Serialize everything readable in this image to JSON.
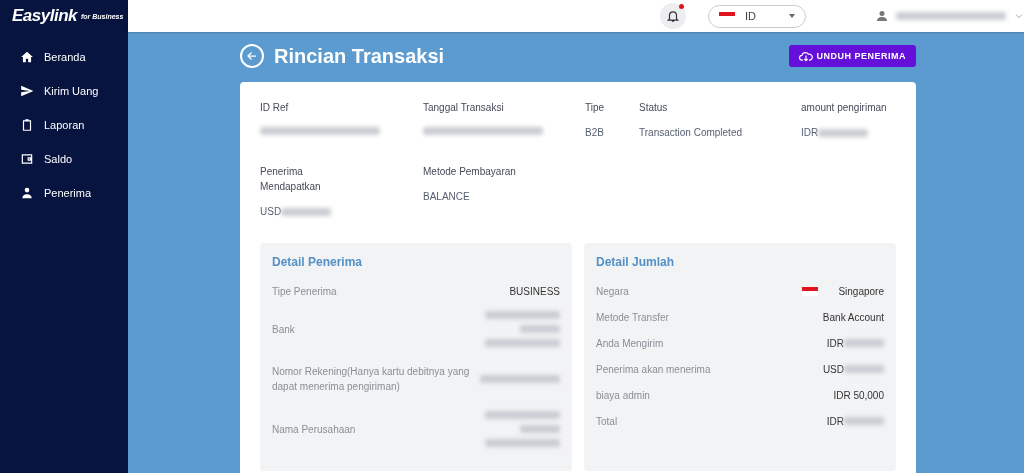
{
  "brand": {
    "logo": "Easylink",
    "tagline": "for Business"
  },
  "sidebar": {
    "items": [
      {
        "label": "Beranda",
        "kind": "home"
      },
      {
        "label": "Kirim Uang",
        "kind": "send"
      },
      {
        "label": "Laporan",
        "kind": "report"
      },
      {
        "label": "Saldo",
        "kind": "wallet"
      },
      {
        "label": "Penerima",
        "kind": "person"
      }
    ]
  },
  "header": {
    "notifications": {
      "unread": true
    },
    "language": {
      "value": "ID"
    },
    "user": {
      "redacted": true
    }
  },
  "page": {
    "title": "Rincian Transaksi",
    "download_button": "UNDUH PENERIMA"
  },
  "summary": {
    "fields": [
      {
        "label": "ID Ref",
        "kind": "blurred"
      },
      {
        "label": "Tanggal Transaksi",
        "kind": "blurred"
      },
      {
        "label": "Tipe",
        "value": "B2B",
        "kind": "text"
      },
      {
        "label": "Status",
        "value": "Transaction Completed",
        "kind": "text"
      },
      {
        "label": "amount pengiriman",
        "value": "IDR",
        "kind": "prefix_blurred"
      },
      {
        "label": "Penerima Mendapatkan",
        "value": "USD",
        "kind": "prefix_blurred"
      },
      {
        "label": "Metode Pembayaran",
        "value": "BALANCE",
        "kind": "text"
      }
    ]
  },
  "panels": [
    {
      "title": "Detail Penerima",
      "rows": [
        {
          "label": "Tipe Penerima",
          "value": "BUSINESS",
          "kind": "text"
        },
        {
          "label": "Bank",
          "kind": "blurred_stack"
        },
        {
          "label": "Nomor Rekening(Hanya kartu debitnya yang dapat menerima pengiriman)",
          "kind": "blurred"
        },
        {
          "label": "Nama Perusahaan",
          "kind": "blurred_stack"
        }
      ]
    },
    {
      "title": "Detail Jumlah",
      "rows": [
        {
          "label": "Negara",
          "value": "Singapore",
          "kind": "flag"
        },
        {
          "label": "Metode Transfer",
          "value": "Bank Account",
          "kind": "text"
        },
        {
          "label": "Anda Mengirim",
          "value": "IDR",
          "kind": "prefix_blurred"
        },
        {
          "label": "Penerima akan menerima",
          "value": "USD",
          "kind": "prefix_blurred"
        },
        {
          "label": "biaya admin",
          "value": "IDR 50,000",
          "kind": "text"
        },
        {
          "label": "Total",
          "value": "IDR",
          "kind": "prefix_blurred"
        }
      ]
    }
  ]
}
